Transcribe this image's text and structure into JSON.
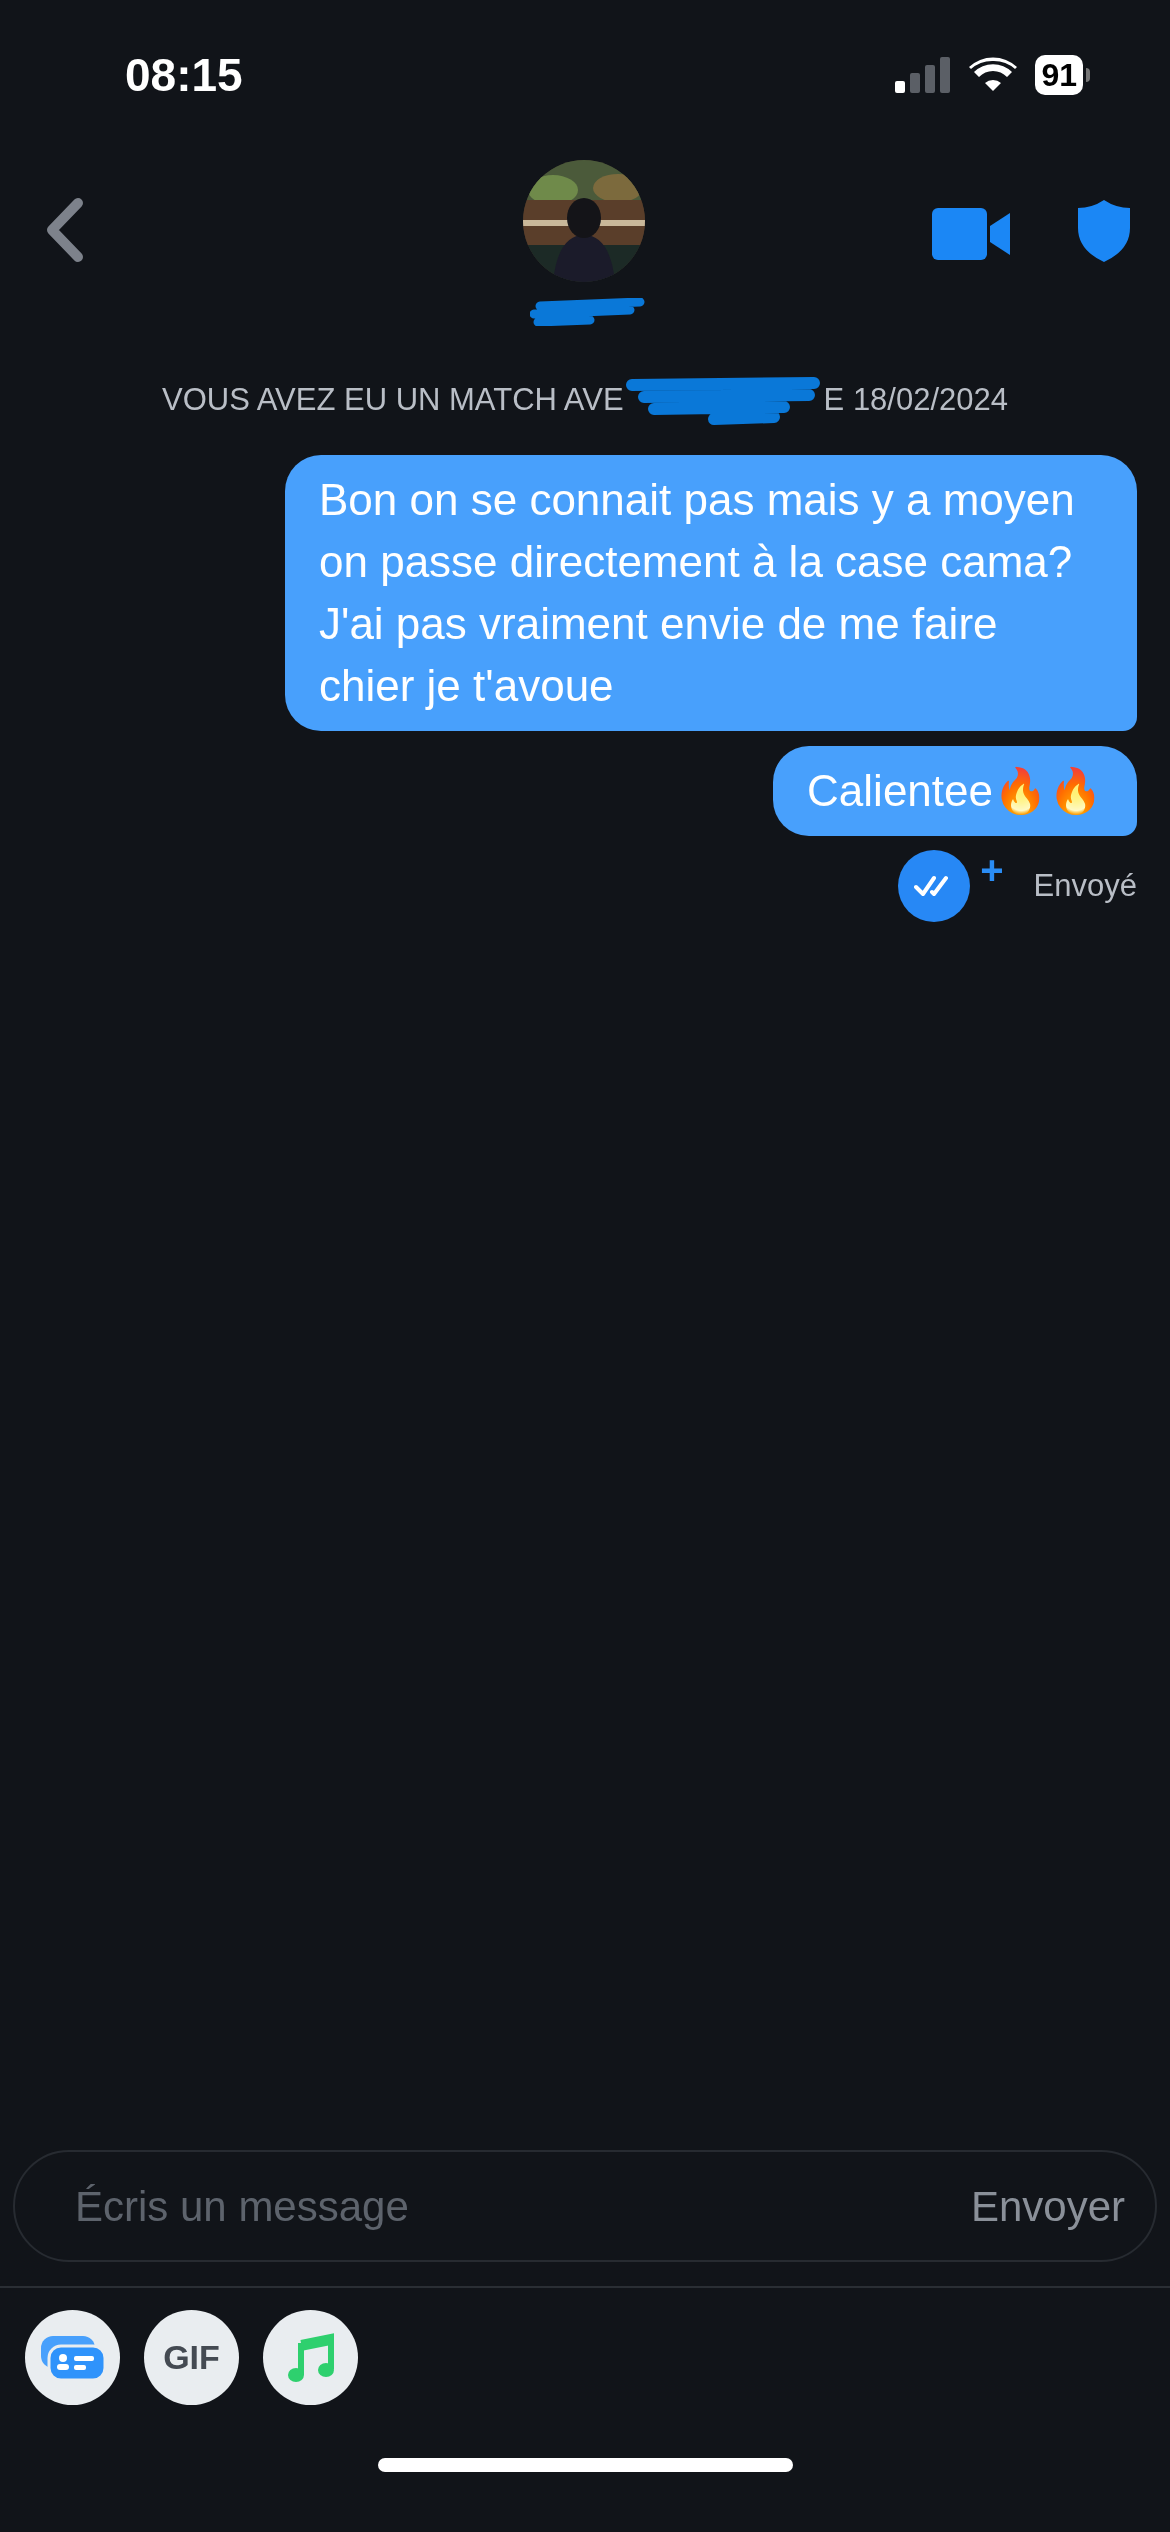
{
  "status_bar": {
    "time": "08:15",
    "battery": "91"
  },
  "match_notice": {
    "before": "VOUS AVEZ EU UN MATCH AVE",
    "after": "E 18/02/2024"
  },
  "messages": [
    {
      "text": "Bon on se connait pas mais y a moyen on passe directement à la case cama? J'ai pas vraiment envie de me faire chier je t'avoue"
    },
    {
      "text": "Calientee🔥🔥"
    }
  ],
  "receipt": {
    "plus": "+",
    "status": "Envoyé"
  },
  "composer": {
    "placeholder": "Écris un message",
    "send": "Envoyer"
  },
  "tools": [
    {
      "kind": "card"
    },
    {
      "kind": "gif",
      "label": "GIF"
    },
    {
      "kind": "music"
    }
  ]
}
